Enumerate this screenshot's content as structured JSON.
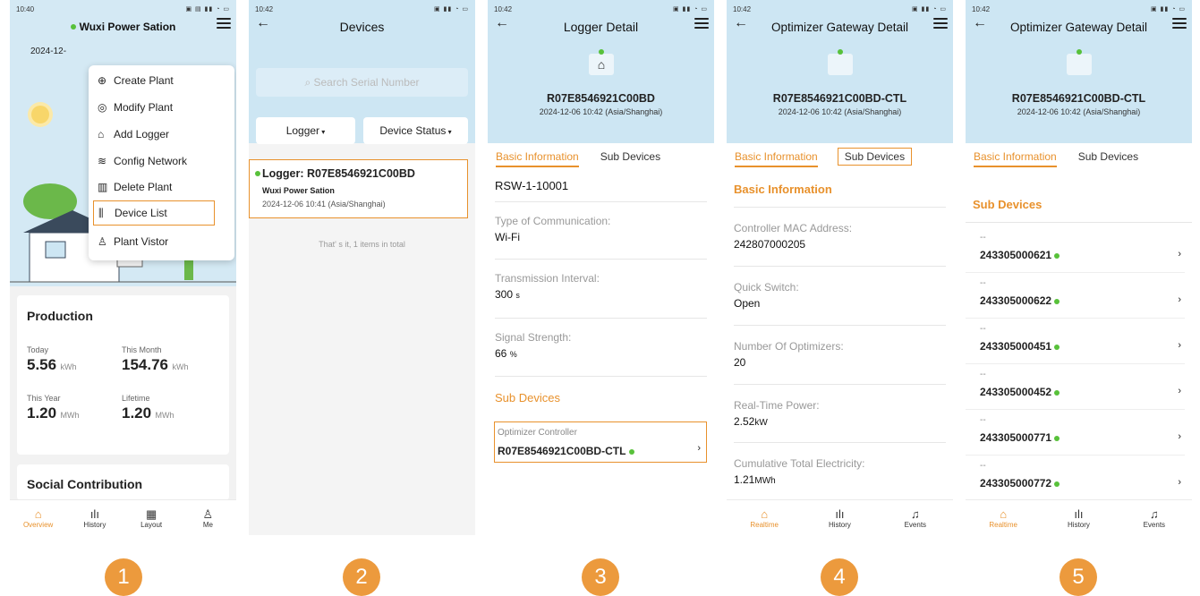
{
  "status_times": [
    "10:40",
    "10:42",
    "10:42",
    "10:42",
    "10:42"
  ],
  "s1": {
    "plant_name": "Wuxi Power Sation",
    "date_partial": "2024-12-",
    "menu": [
      "Create Plant",
      "Modify Plant",
      "Add Logger",
      "Config Network",
      "Delete Plant",
      "Device List",
      "Plant Vistor"
    ],
    "production_title": "Production",
    "today_label": "Today",
    "today_value": "5.56",
    "today_unit": "kWh",
    "month_label": "This Month",
    "month_value": "154.76",
    "month_unit": "kWh",
    "year_label": "This Year",
    "year_value": "1.20",
    "year_unit": "MWh",
    "life_label": "Lifetime",
    "life_value": "1.20",
    "life_unit": "MWh",
    "social_title": "Social Contribution",
    "nav": [
      "Overview",
      "History",
      "Layout",
      "Me"
    ]
  },
  "s2": {
    "title": "Devices",
    "search_placeholder": "Search Serial Number",
    "filter_type": "Logger",
    "filter_status": "Device Status",
    "item_title": "Logger: R07E8546921C00BD",
    "item_plant": "Wuxi Power Sation",
    "item_time": "2024-12-06 10:41 (Asia/Shanghai)",
    "total_text": "That' s it, 1 items in total"
  },
  "s3": {
    "title": "Logger Detail",
    "serial": "R07E8546921C00BD",
    "stamp": "2024-12-06 10:42 (Asia/Shanghai)",
    "tab1": "Basic Information",
    "tab2": "Sub Devices",
    "model": "RSW-1-10001",
    "comm_label": "Type of Communication:",
    "comm_value": "Wi-Fi",
    "interval_label": "Transmission Interval:",
    "interval_value": "300",
    "interval_unit": "s",
    "signal_label": "Signal Strength:",
    "signal_value": "66",
    "signal_unit": "%",
    "sub_title": "Sub Devices",
    "sub_kind": "Optimizer Controller",
    "sub_serial": "R07E8546921C00BD-CTL"
  },
  "s4": {
    "title": "Optimizer Gateway Detail",
    "serial": "R07E8546921C00BD-CTL",
    "stamp": "2024-12-06 10:42 (Asia/Shanghai)",
    "tab1": "Basic Information",
    "tab2": "Sub Devices",
    "section": "Basic Information",
    "mac_label": "Controller MAC Address:",
    "mac_value": "242807000205",
    "switch_label": "Quick Switch:",
    "switch_value": "Open",
    "opt_label": "Number Of Optimizers:",
    "opt_value": "20",
    "power_label": "Real-Time Power:",
    "power_value": "2.52",
    "power_unit": "kW",
    "elec_label": "Cumulative Total Electricity:",
    "elec_value": "1.21",
    "elec_unit": "MWh",
    "nav": [
      "Realtime",
      "History",
      "Events"
    ]
  },
  "s5": {
    "title": "Optimizer Gateway Detail",
    "serial": "R07E8546921C00BD-CTL",
    "stamp": "2024-12-06 10:42 (Asia/Shanghai)",
    "tab1": "Basic Information",
    "tab2": "Sub Devices",
    "section": "Sub Devices",
    "dash": "--",
    "items": [
      "243305000621",
      "243305000622",
      "243305000451",
      "243305000452",
      "243305000771",
      "243305000772"
    ],
    "nav": [
      "Realtime",
      "History",
      "Events"
    ]
  },
  "steps": [
    "1",
    "2",
    "3",
    "4",
    "5"
  ],
  "colors": {
    "accent": "#e8912c",
    "header_bg": "#cde6f3",
    "online": "#58c13a",
    "badge": "#ec9a3d"
  },
  "icons": [
    "plus-circle-icon",
    "target-icon",
    "router-icon",
    "wifi-icon",
    "trash-icon",
    "device-list-icon",
    "user-icon",
    "back-arrow-icon",
    "hamburger-icon",
    "chevron-right-icon",
    "search-icon",
    "home-icon",
    "history-icon",
    "layout-icon",
    "me-icon",
    "bell-icon"
  ]
}
